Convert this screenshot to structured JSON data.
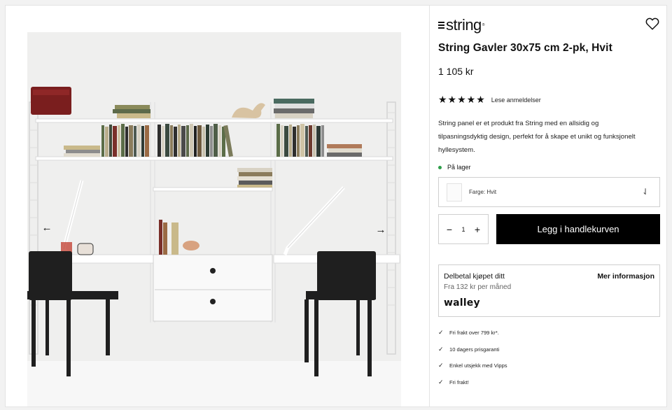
{
  "brand": {
    "logo_text": "string",
    "logo_mark": "®"
  },
  "product": {
    "title": "String Gavler 30x75 cm 2-pk, Hvit",
    "price": "1 105 kr",
    "rating": 5,
    "rating_stars": "★★★★★",
    "reviews_link": "Lese anmeldelser",
    "description": "String panel er et produkt fra String med en allsidig og tilpasningsdyktig design, perfekt for å skape et unikt og funksjonelt hyllesystem.",
    "stock_status": "På lager",
    "stock_color": "#2e9e4a"
  },
  "variant": {
    "label": "Farge: Hvit",
    "selected": "Hvit"
  },
  "quantity": {
    "value": "1",
    "minus": "−",
    "plus": "+"
  },
  "cart": {
    "button_label": "Legg i handlekurven"
  },
  "payment": {
    "title": "Delbetal kjøpet ditt",
    "more_info": "Mer informasjon",
    "monthly": "Fra 132 kr per måned",
    "provider": "walley"
  },
  "usps": [
    "Fri frakt over 799 kr*.",
    "10 dagers prisgaranti",
    "Enkel utsjekk med Vipps",
    "Fri frakt!"
  ],
  "gallery": {
    "prev_icon": "arrow-left-icon",
    "next_icon": "arrow-right-icon",
    "prev_glyph": "←",
    "next_glyph": "→"
  },
  "icons": {
    "wishlist": "heart-icon",
    "dropdown": "chevron-down-icon",
    "check": "check-icon"
  }
}
